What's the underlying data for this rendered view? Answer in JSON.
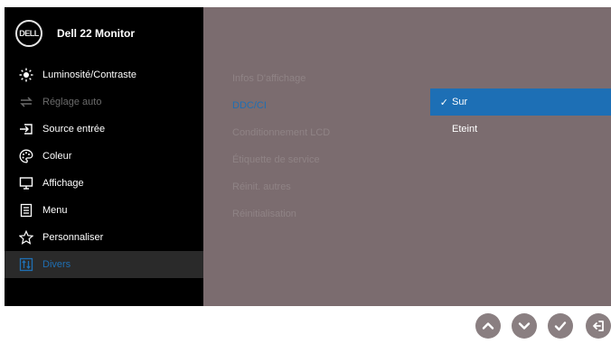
{
  "header": {
    "logo_text": "DELL",
    "title": "Dell 22 Monitor"
  },
  "menu": {
    "items": [
      {
        "label": "Luminosité/Contraste",
        "icon": "brightness-icon",
        "state": "normal"
      },
      {
        "label": "Réglage auto",
        "icon": "auto-adjust-icon",
        "state": "disabled"
      },
      {
        "label": "Source entrée",
        "icon": "input-source-icon",
        "state": "normal"
      },
      {
        "label": "Coleur",
        "icon": "color-palette-icon",
        "state": "normal"
      },
      {
        "label": "Affichage",
        "icon": "display-icon",
        "state": "normal"
      },
      {
        "label": "Menu",
        "icon": "menu-icon",
        "state": "normal"
      },
      {
        "label": "Personnaliser",
        "icon": "star-icon",
        "state": "normal"
      },
      {
        "label": "Divers",
        "icon": "others-icon",
        "state": "selected"
      }
    ]
  },
  "submenu": {
    "items": [
      {
        "label": "Infos D'affichage",
        "state": "normal"
      },
      {
        "label": "DDC/CI",
        "state": "active"
      },
      {
        "label": "Conditionnement LCD",
        "state": "normal"
      },
      {
        "label": "Étiquette de service",
        "state": "normal"
      },
      {
        "label": "Réinit. autres",
        "state": "normal"
      },
      {
        "label": "Réinitialisation",
        "state": "normal"
      }
    ]
  },
  "options": {
    "checkmark": "✓",
    "items": [
      {
        "label": "Sur",
        "selected": true
      },
      {
        "label": "Eteint",
        "selected": false
      }
    ]
  },
  "buttons": [
    {
      "name": "up-button",
      "icon": "chevron-up-icon"
    },
    {
      "name": "down-button",
      "icon": "chevron-down-icon"
    },
    {
      "name": "ok-button",
      "icon": "check-icon"
    },
    {
      "name": "back-button",
      "icon": "back-icon"
    }
  ],
  "colors": {
    "background": "#000000",
    "panel": "#7b6c6f",
    "accent": "#1d6fb5",
    "disabled_text": "#6b6b6b"
  }
}
